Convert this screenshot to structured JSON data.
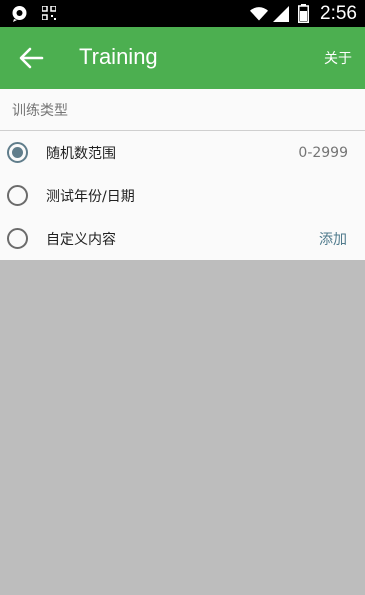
{
  "status_bar": {
    "time": "2:56",
    "icons": [
      "chat-icon",
      "qr-icon",
      "wifi-icon",
      "signal-icon",
      "battery-icon"
    ]
  },
  "app_bar": {
    "title": "Training",
    "back_icon": "arrow-left-icon",
    "menu_action": "关于",
    "color": "#4caf50"
  },
  "section": {
    "header": "训练类型",
    "options": [
      {
        "label": "随机数范围",
        "value": "0-2999",
        "action": "",
        "selected": true
      },
      {
        "label": "测试年份/日期",
        "value": "",
        "action": "",
        "selected": false
      },
      {
        "label": "自定义内容",
        "value": "",
        "action": "添加",
        "selected": false
      }
    ]
  },
  "colors": {
    "accent": "#607d8b",
    "link": "#4f7a8c",
    "background": "#bdbdbd"
  }
}
